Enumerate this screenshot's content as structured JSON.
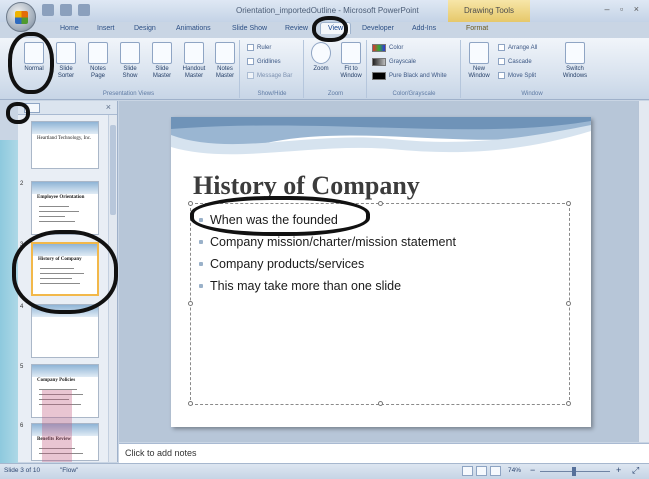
{
  "titlebar": {
    "title": "Orientation_importedOutline - Microsoft PowerPoint",
    "context_tab_title": "Drawing Tools"
  },
  "tabs": [
    "Home",
    "Insert",
    "Design",
    "Animations",
    "Slide Show",
    "Review",
    "View",
    "Developer",
    "Add-Ins",
    "Format"
  ],
  "active_tab": "View",
  "ribbon": {
    "presentation_views": {
      "label": "Presentation Views",
      "buttons": [
        "Normal",
        "Slide Sorter",
        "Notes Page",
        "Slide Show",
        "Slide Master",
        "Handout Master",
        "Notes Master"
      ]
    },
    "show_hide": {
      "label": "Show/Hide",
      "items": [
        "Ruler",
        "Gridlines",
        "Message Bar"
      ]
    },
    "zoom": {
      "label": "Zoom",
      "buttons": [
        "Zoom",
        "Fit to Window"
      ]
    },
    "color_grayscale": {
      "label": "Color/Grayscale",
      "items": [
        "Color",
        "Grayscale",
        "Pure Black and White"
      ]
    },
    "window": {
      "label": "Window",
      "new_window": "New Window",
      "items": [
        "Arrange All",
        "Cascade",
        "Move Split"
      ],
      "switch": "Switch Windows"
    }
  },
  "thumbnails": [
    {
      "num": "",
      "title": "Heartland Technology, Inc."
    },
    {
      "num": "2",
      "title": "Employee Orientation"
    },
    {
      "num": "3",
      "title": "History of Company"
    },
    {
      "num": "4",
      "title": ""
    },
    {
      "num": "5",
      "title": "Company Policies"
    },
    {
      "num": "6",
      "title": "Benefits Review"
    }
  ],
  "slide": {
    "title": "History of Company",
    "bullets": [
      "When was the founded",
      "Company mission/charter/mission statement",
      "Company products/services",
      "This may take more than one slide"
    ]
  },
  "notes_placeholder": "Click to add notes",
  "status": {
    "slide_info": "Slide 3 of 10",
    "theme": "\"Flow\"",
    "zoom": "74%"
  }
}
